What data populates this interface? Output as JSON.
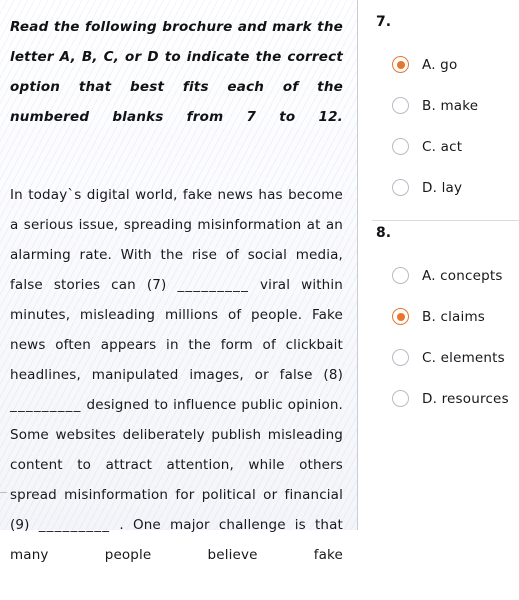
{
  "document": {
    "instructions": "Read the following brochure and mark the letter A, B, C, or D to indicate the correct option that best fits each of the numbered blanks from 7 to 12.",
    "passage_part_1": "In today`s digital world, fake news has become a serious issue, spreading misinformation at an alarming rate. With the rise of social media, false stories can (7)",
    "blank_1": "_________",
    "passage_part_2": "viral within minutes, misleading millions of people. Fake news often appears in the form of clickbait headlines, manipulated images, or false (8)",
    "blank_2": "_________",
    "passage_part_3": "designed to influence public opinion. Some websites deliberately publish misleading content to attract attention, while others spread misinformation for political or financial (9)",
    "blank_3": "_________",
    "passage_part_4": ". One major challenge is that many people believe fake"
  },
  "questions": [
    {
      "number": "7.",
      "options": [
        {
          "label": "A. go",
          "selected": true
        },
        {
          "label": "B. make",
          "selected": false
        },
        {
          "label": "C. act",
          "selected": false
        },
        {
          "label": "D. lay",
          "selected": false
        }
      ]
    },
    {
      "number": "8.",
      "options": [
        {
          "label": "A. concepts",
          "selected": false
        },
        {
          "label": "B. claims",
          "selected": true
        },
        {
          "label": "C. elements",
          "selected": false
        },
        {
          "label": "D. resources",
          "selected": false
        }
      ]
    }
  ],
  "colors": {
    "accent": "#e8772e",
    "text": "#17181c",
    "radio_border": "#b9bcc6"
  }
}
